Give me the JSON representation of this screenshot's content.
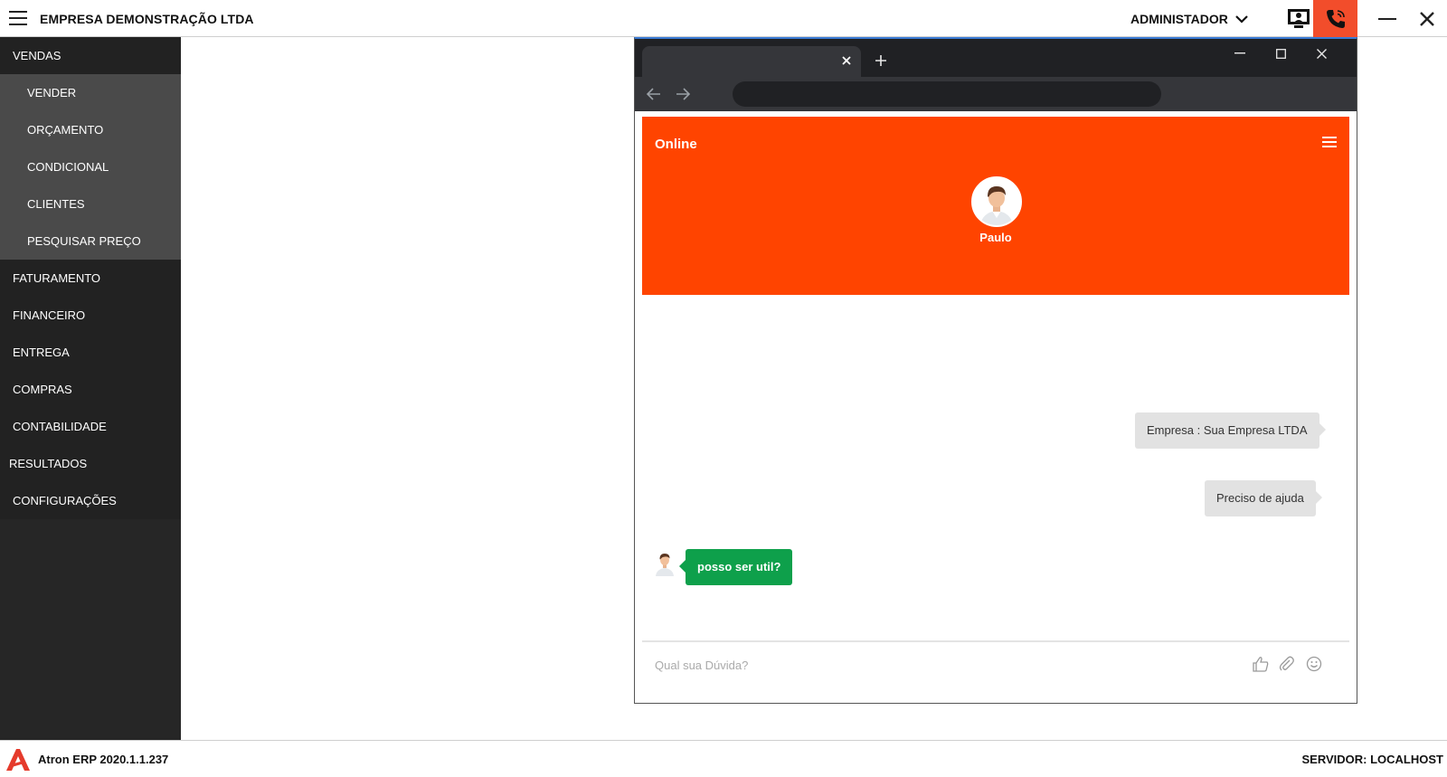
{
  "header": {
    "company": "EMPRESA DEMONSTRAÇÃO LTDA",
    "user": "ADMINISTADOR",
    "accent_color": "#f24d2b"
  },
  "sidebar": {
    "items": [
      {
        "label": "VENDAS"
      },
      {
        "label": "VENDER"
      },
      {
        "label": "ORÇAMENTO"
      },
      {
        "label": "CONDICIONAL"
      },
      {
        "label": "CLIENTES"
      },
      {
        "label": "PESQUISAR PREÇO"
      },
      {
        "label": "FATURAMENTO"
      },
      {
        "label": "FINANCEIRO"
      },
      {
        "label": "ENTREGA"
      },
      {
        "label": "COMPRAS"
      },
      {
        "label": "CONTABILIDADE"
      },
      {
        "label": "RESULTADOS"
      },
      {
        "label": "CONFIGURAÇÕES"
      }
    ]
  },
  "status_bar": {
    "version": "Atron ERP 2020.1.1.237",
    "server": "SERVIDOR: LOCALHOST"
  },
  "browser": {
    "address": ""
  },
  "chat": {
    "status": "Online",
    "agent_name": "Paulo",
    "header_color": "#ff4400",
    "messages": [
      {
        "from": "user",
        "text": "Empresa : Sua Empresa LTDA"
      },
      {
        "from": "user",
        "text": "Preciso de ajuda"
      },
      {
        "from": "agent",
        "text": "posso ser util?"
      }
    ],
    "input_placeholder": "Qual sua Dúvida?"
  }
}
